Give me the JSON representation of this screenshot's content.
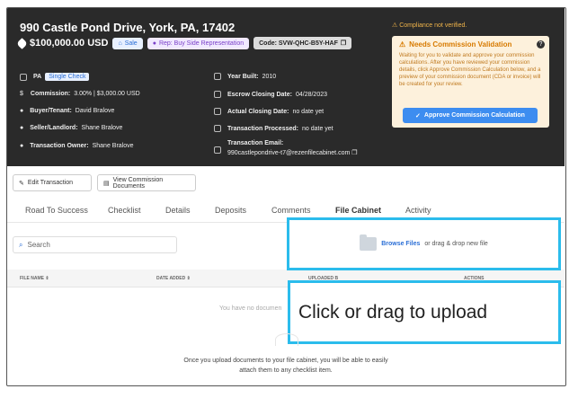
{
  "header": {
    "address": "990 Castle Pond Drive, York, PA, 17402",
    "price": "$100,000.00 USD",
    "badge_sale": "Sale",
    "badge_rep": "Rep: Buy Side Representation",
    "badge_code": "Code: SVW-QHC-B5Y-HAF",
    "state": "PA",
    "single_check": "Single Check",
    "commission_label": "Commission:",
    "commission_value": "3.00% | $3,000.00 USD",
    "buyer_label": "Buyer/Tenant:",
    "buyer_value": "David Bralove",
    "seller_label": "Seller/Landlord:",
    "seller_value": "Shane Bralove",
    "owner_label": "Transaction Owner:",
    "owner_value": "Shane Bralove",
    "year_label": "Year Built:",
    "year_value": "2010",
    "escrow_label": "Escrow Closing Date:",
    "escrow_value": "04/28/2023",
    "actual_label": "Actual Closing Date:",
    "actual_value": "no date yet",
    "processed_label": "Transaction Processed:",
    "processed_value": "no date yet",
    "email_label": "Transaction Email:",
    "email_value": "990castlepondrive-t7@rezenfilecabinet.com"
  },
  "commission": {
    "warning": "Compliance not verified.",
    "title": "Needs Commission Validation",
    "text": "Waiting for you to validate and approve your commission calculations. After you have reviewed your commission details, click Approve Commission Calculation below, and a preview of your commission document (CDA or invoice) will be created for your review.",
    "approve_label": "Approve Commission Calculation"
  },
  "actions": {
    "edit_label": "Edit Transaction",
    "view_docs_label": "View Commission Documents"
  },
  "tabs": [
    "Road To Success",
    "Checklist",
    "Details",
    "Deposits",
    "Comments",
    "File Cabinet",
    "Activity"
  ],
  "active_tab": "File Cabinet",
  "search": {
    "placeholder": "Search"
  },
  "upload": {
    "link": "Browse Files",
    "text": "or drag & drop new file"
  },
  "table": {
    "columns": [
      "FILE NAME ⇕",
      "DATE ADDED ⇕",
      "UPLOADED B",
      "ACTIONS"
    ]
  },
  "empty_text": "You have no documen",
  "tooltip": "Click or drag to upload",
  "footer_text": "Once you upload documents to your file cabinet, you will be able to easily attach them to any checklist item.",
  "colors": {
    "header_bg": "#2a2a2a",
    "accent_blue": "#3d8df0",
    "highlight": "#2bbcec",
    "warning": "#d77a00"
  }
}
